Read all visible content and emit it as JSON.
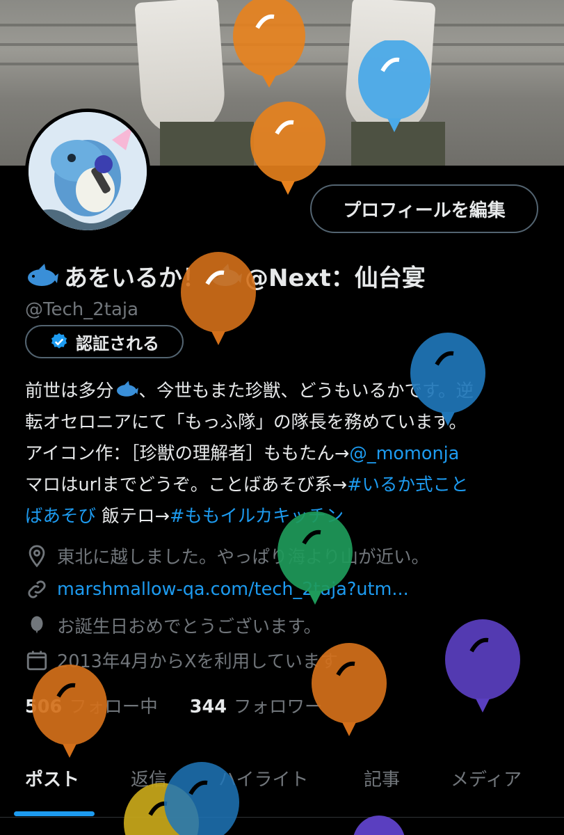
{
  "profile": {
    "display_name": "あをいるか！",
    "display_name_suffix": "@Next：仙台宴",
    "handle": "@Tech_2taja",
    "edit_button_label": "プロフィールを編集",
    "verify_button_label": "認証される"
  },
  "bio": {
    "line1": "前世は多分",
    "line1b": "、今世もまた珍獣、どうもいるかです。逆",
    "line2": "転オセロニアにて「もっふ隊」の隊長を務めています。",
    "line3": "アイコン作：［珍獣の理解者］ももたん→",
    "line3_link": "@_momonja",
    "line4": "マロはurlまでどうぞ。ことばあそび系→",
    "line4_link": "#いるか式こと",
    "line5_link": "ばあそび",
    "line5": " 飯テロ→",
    "line5_link2": "#ももイルカキッチン"
  },
  "meta": {
    "location": "東北に越しました。やっぱり海より山が近い。",
    "url": "marshmallow-qa.com/tech_2taja?utm...",
    "birthday": "お誕生日おめでとうございます。",
    "joined": "2013年4月からXを利用しています"
  },
  "stats": {
    "following_count": "506",
    "following_label": "フォロー中",
    "followers_count": "344",
    "followers_label": "フォロワー"
  },
  "tabs": [
    {
      "label": "ポスト"
    },
    {
      "label": "返信"
    },
    {
      "label": "ハイライト"
    },
    {
      "label": "記事"
    },
    {
      "label": "メディア"
    }
  ],
  "colors": {
    "accent": "#1d9bf0",
    "background": "#000000",
    "text_primary": "#e7e9ea",
    "text_secondary": "#71767b"
  },
  "icons": [
    "dolphin-emoji",
    "verified-badge-icon",
    "location-pin-icon",
    "link-icon",
    "balloon-icon",
    "calendar-icon"
  ]
}
